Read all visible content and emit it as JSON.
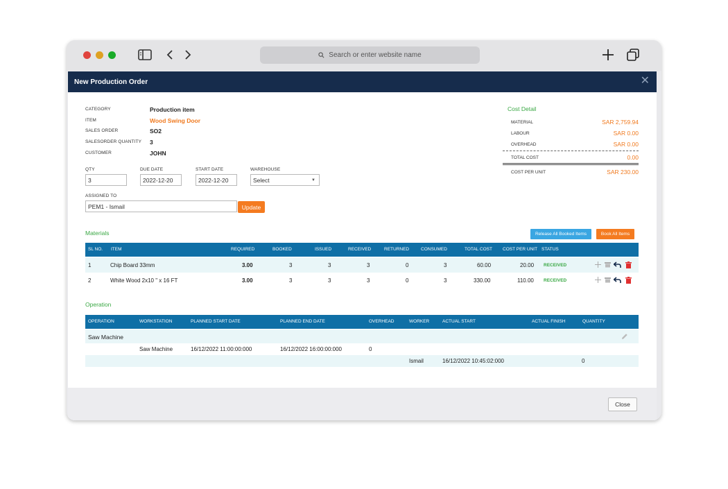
{
  "browser": {
    "url_placeholder": "Search or enter website name"
  },
  "modal": {
    "title": "New Production Order",
    "close_glyph": "✕"
  },
  "details": {
    "category_label": "CATEGORY",
    "category_value": "Production item",
    "item_label": "ITEM",
    "item_value": "Wood Swing Door",
    "sales_order_label": "SALES ORDER",
    "sales_order_value": "SO2",
    "so_qty_label": "SALESORDER QUANTITY",
    "so_qty_value": "3",
    "customer_label": "CUSTOMER",
    "customer_value": "JOHN"
  },
  "form": {
    "qty_label": "QTY",
    "qty_value": "3",
    "due_date_label": "DUE DATE",
    "due_date_value": "2022-12-20",
    "start_date_label": "START DATE",
    "start_date_value": "2022-12-20",
    "warehouse_label": "WAREHOUSE",
    "warehouse_value": "Select",
    "assigned_label": "ASSIGNED TO",
    "assigned_value": "PEM1 - Ismail",
    "update_label": "Update"
  },
  "cost": {
    "title": "Cost Detail",
    "material_label": "MATERIAL",
    "material_value": "SAR 2,759.94",
    "labour_label": "LABOUR",
    "labour_value": "SAR 0.00",
    "overhead_label": "OVERHEAD",
    "overhead_value": "SAR 0.00",
    "total_label": "TOTAL COST",
    "total_value": "0.00",
    "per_unit_label": "COST PER UNIT",
    "per_unit_value": "SAR 230.00"
  },
  "materials": {
    "title": "Materials",
    "release_label": "Release All Booked Items",
    "book_label": "Book All Items",
    "headers": [
      "SL NO.",
      "ITEM",
      "REQUIRED",
      "BOOKED",
      "ISSUED",
      "RECEIVED",
      "RETURNED",
      "CONSUMED",
      "TOTAL COST",
      "COST PER UNIT",
      "STATUS"
    ],
    "rows": [
      {
        "sl": "1",
        "item": "Chip Board 33mm",
        "required": "3.00",
        "booked": "3",
        "issued": "3",
        "received": "3",
        "returned": "0",
        "consumed": "3",
        "total_cost": "60.00",
        "cost_per_unit": "20.00",
        "status": "RECEIVED"
      },
      {
        "sl": "2",
        "item": "White Wood 2x10 \" x 16 FT",
        "required": "3.00",
        "booked": "3",
        "issued": "3",
        "received": "3",
        "returned": "0",
        "consumed": "3",
        "total_cost": "330.00",
        "cost_per_unit": "110.00",
        "status": "RECEIVED"
      }
    ]
  },
  "operation": {
    "title": "Operation",
    "headers": [
      "OPERATION",
      "WORKSTATION",
      "PLANNED START DATE",
      "PLANNED END DATE",
      "OVERHEAD",
      "WORKER",
      "ACTUAL START",
      "ACTUAL FINISH",
      "QUANTITY"
    ],
    "group_name": "Saw Machine",
    "row1": {
      "workstation": "Saw Machine",
      "planned_start": "16/12/2022 11:00:00:000",
      "planned_end": "16/12/2022 16:00:00:000",
      "overhead": "0"
    },
    "row2": {
      "worker": "Ismail",
      "actual_start": "16/12/2022 10:45:02:000",
      "quantity": "0"
    }
  },
  "footer": {
    "close_label": "Close"
  },
  "colors": {
    "header_bg": "#162c4c",
    "table_header": "#0f6fa6",
    "accent_orange": "#f47b20",
    "accent_green": "#3aa844",
    "accent_blue": "#3aa6e2"
  }
}
